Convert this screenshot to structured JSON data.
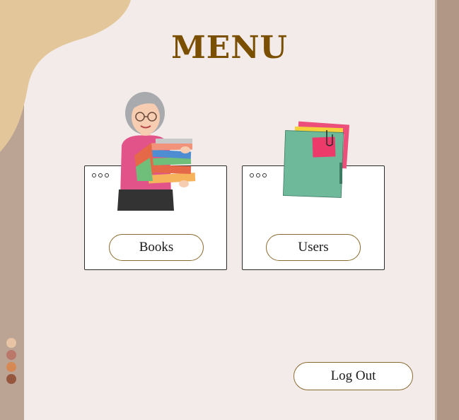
{
  "page": {
    "title": "MENU"
  },
  "menu": {
    "books": {
      "label": "Books"
    },
    "users": {
      "label": "Users"
    }
  },
  "actions": {
    "logout_label": "Log Out"
  },
  "colors": {
    "background": "#f2ebe9",
    "title": "#7a4f00",
    "blob": "#e3c79b",
    "pill_border": "#8b6a2e",
    "swatches": [
      "#e8c3a4",
      "#b9786a",
      "#d68954",
      "#96553e"
    ]
  },
  "icons": [
    "reader-with-books-icon",
    "folder-with-notes-icon"
  ]
}
